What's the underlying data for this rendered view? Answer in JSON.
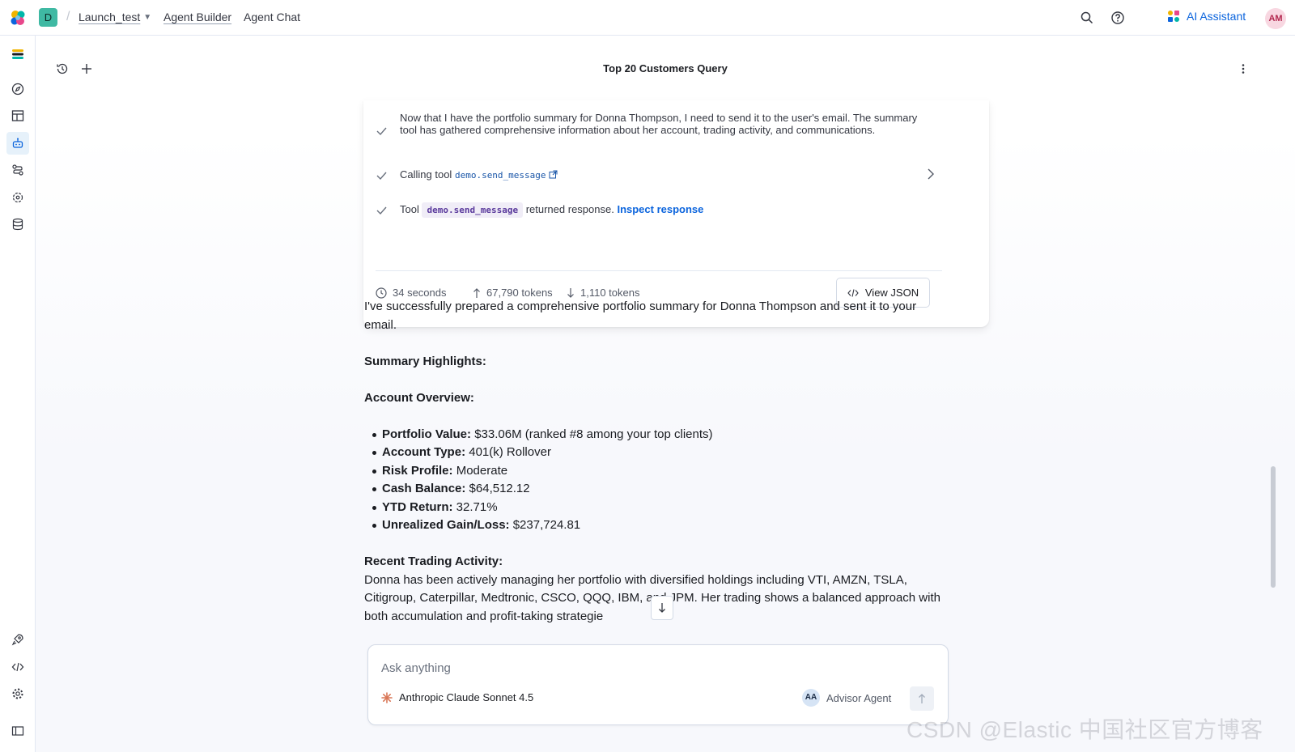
{
  "header": {
    "space_initial": "D",
    "breadcrumbs": [
      "Launch_test",
      "Agent Builder",
      "Agent Chat"
    ],
    "ai_assistant_label": "AI Assistant",
    "user_initials": "AM"
  },
  "chat": {
    "title": "Top 20 Customers Query"
  },
  "reasoning": {
    "thought": "Now that I have the portfolio summary for Donna Thompson, I need to send it to the user's email. The summary tool has gathered comprehensive information about her account, trading activity, and communications.",
    "calling_prefix": "Calling tool",
    "calling_tool": "demo.send_message",
    "returned_prefix": "Tool",
    "returned_tool": "demo.send_message",
    "returned_suffix": "returned response.",
    "inspect_link": "Inspect response",
    "duration": "34 seconds",
    "tokens_in": "67,790 tokens",
    "tokens_out": "1,110 tokens",
    "view_json_label": "View JSON"
  },
  "response": {
    "intro": "I've successfully prepared a comprehensive portfolio summary for Donna Thompson and sent it to your email.",
    "summary_heading": "Summary Highlights:",
    "account_heading": "Account Overview:",
    "account_items": [
      {
        "label": "Portfolio Value:",
        "value": "$33.06M (ranked #8 among your top clients)"
      },
      {
        "label": "Account Type:",
        "value": "401(k) Rollover"
      },
      {
        "label": "Risk Profile:",
        "value": "Moderate"
      },
      {
        "label": "Cash Balance:",
        "value": "$64,512.12"
      },
      {
        "label": "YTD Return:",
        "value": "32.71%"
      },
      {
        "label": "Unrealized Gain/Loss:",
        "value": "$237,724.81"
      }
    ],
    "trading_heading": "Recent Trading Activity:",
    "trading_text": "Donna has been actively managing her portfolio with diversified holdings including VTI, AMZN, TSLA, Citigroup, Caterpillar, Medtronic, CSCO, QQQ, IBM, and JPM. Her trading shows a balanced approach with both accumulation and profit-taking strategie"
  },
  "composer": {
    "placeholder": "Ask anything",
    "model": "Anthropic Claude Sonnet 4.5",
    "agent_initials": "AA",
    "agent": "Advisor Agent"
  },
  "watermark": "CSDN @Elastic 中国社区官方博客"
}
